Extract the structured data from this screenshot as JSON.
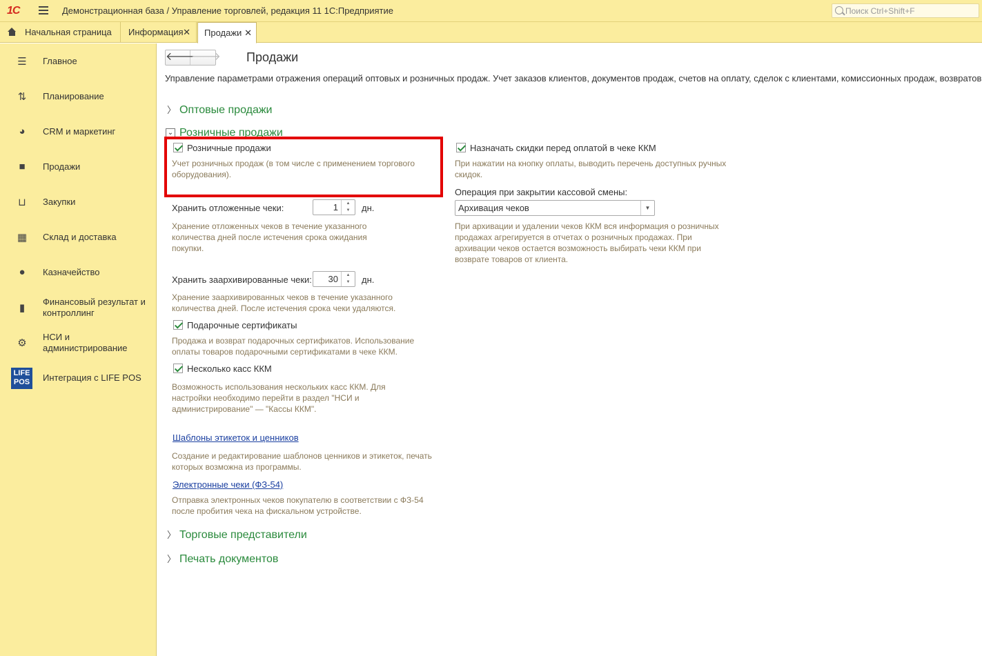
{
  "app": {
    "logo": "1С",
    "title": "Демонстрационная база / Управление торговлей, редакция 11 1С:Предприятие",
    "search_placeholder": "Поиск Ctrl+Shift+F"
  },
  "tabs": [
    {
      "label": "Начальная страница"
    },
    {
      "label": "Информация",
      "close": "✕"
    },
    {
      "label": "Продажи",
      "close": "✕"
    }
  ],
  "sidebar": {
    "items": [
      {
        "label": "Главное",
        "icon": "list-icon"
      },
      {
        "label": "Планирование",
        "icon": "planning-icon"
      },
      {
        "label": "CRM и маркетинг",
        "icon": "pie-chart-icon"
      },
      {
        "label": "Продажи",
        "icon": "bag-icon"
      },
      {
        "label": "Закупки",
        "icon": "cart-icon"
      },
      {
        "label": "Склад и доставка",
        "icon": "warehouse-icon"
      },
      {
        "label": "Казначейство",
        "icon": "ruble-icon"
      },
      {
        "label": "Финансовый результат и контроллинг",
        "icon": "bar-chart-icon"
      },
      {
        "label": "НСИ и администрирование",
        "icon": "gear-icon"
      },
      {
        "label": "Интеграция с LIFE POS",
        "icon": "lifepos-icon",
        "logo_text": "LIFE POS"
      }
    ]
  },
  "main": {
    "title": "Продажи",
    "description": "Управление параметрами отражения операций оптовых и розничных продаж. Учет заказов клиентов, документов продаж, счетов на оплату, сделок с клиентами, комиссионных продаж, возвратов",
    "sections": {
      "wholesale": "Оптовые продажи",
      "retail": "Розничные продажи",
      "sales_reps": "Торговые представители",
      "print_docs": "Печать документов"
    },
    "retail": {
      "retail_sales_label": "Розничные продажи",
      "retail_sales_hint": "Учет розничных продаж (в том числе с применением торгового оборудования).",
      "deferred_label": "Хранить отложенные чеки:",
      "deferred_value": "1",
      "deferred_unit": "дн.",
      "deferred_hint": "Хранение отложенных чеков в течение указанного количества дней после истечения срока ожидания покупки.",
      "archived_label": "Хранить заархивированные чеки:",
      "archived_value": "30",
      "archived_unit": "дн.",
      "archived_hint": "Хранение заархивированных чеков в течение указанного количества дней. После истечения срока чеки удаляются.",
      "gift_label": "Подарочные сертификаты",
      "gift_hint": "Продажа и возврат подарочных сертификатов. Использование оплаты товаров подарочными сертификатами в чеке ККМ.",
      "multi_kkm_label": "Несколько касс ККМ",
      "multi_kkm_hint": "Возможность использования нескольких касс ККМ. Для настройки необходимо перейти в раздел \"НСИ и администрирование\" — \"Кассы ККМ\".",
      "templates_link": "Шаблоны этикеток и ценников",
      "templates_hint": "Создание и редактирование шаблонов ценников и этикеток, печать которых возможна из программы.",
      "echeck_link": "Электронные чеки (ФЗ-54)",
      "echeck_hint": "Отправка электронных чеков покупателю в соответствии с ФЗ-54 после пробития чека на фискальном устройстве.",
      "discount_label": "Назначать скидки перед оплатой в чеке ККМ",
      "discount_hint": "При нажатии на кнопку оплаты, выводить перечень доступных ручных скидок.",
      "close_shift_label": "Операция при закрытии кассовой смены:",
      "close_shift_value": "Архивация чеков",
      "close_shift_hint": "При архивации и удалении чеков ККМ вся информация о розничных продажах агрегируется в отчетах о розничных продажах. При архивации чеков остается возможность выбирать чеки ККМ при возврате товаров от клиента."
    }
  },
  "colors": {
    "panel": "#fbed9e",
    "section_green": "#2a8a3c",
    "highlight_red": "#e30000",
    "link_blue": "#1a3fa0"
  }
}
